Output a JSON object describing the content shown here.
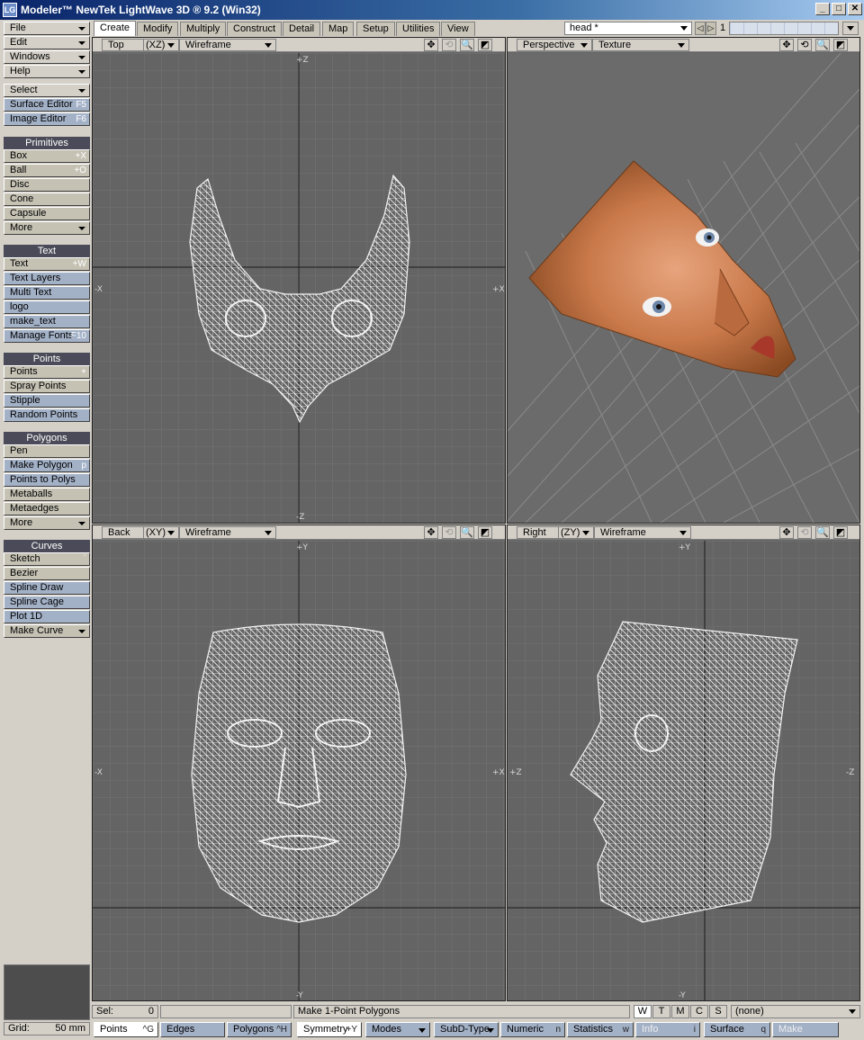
{
  "window": {
    "title": "Modeler™ NewTek LightWave 3D ® 9.2 (Win32)",
    "icon_text": "LG",
    "controls": [
      "_",
      "□",
      "✕"
    ]
  },
  "tabs": [
    "Create",
    "Modify",
    "Multiply",
    "Construct",
    "Detail",
    "Map",
    "Setup",
    "Utilities",
    "View"
  ],
  "active_tab": "Create",
  "layer": {
    "name": "head *",
    "number": "1",
    "prev": "◁",
    "next": "▷"
  },
  "left": {
    "menus": [
      {
        "label": "File"
      },
      {
        "label": "Edit"
      },
      {
        "label": "Windows"
      },
      {
        "label": "Help"
      }
    ],
    "tools": [
      {
        "label": "Select",
        "key": ""
      },
      {
        "label": "Surface Editor",
        "key": "F5"
      },
      {
        "label": "Image Editor",
        "key": "F6"
      }
    ],
    "primitives": {
      "title": "Primitives",
      "items": [
        {
          "label": "Box",
          "key": "+X"
        },
        {
          "label": "Ball",
          "key": "+O"
        },
        {
          "label": "Disc",
          "key": ""
        },
        {
          "label": "Cone",
          "key": ""
        },
        {
          "label": "Capsule",
          "key": ""
        },
        {
          "label": "More",
          "key": ""
        }
      ]
    },
    "text": {
      "title": "Text",
      "items": [
        {
          "label": "Text",
          "key": "+W"
        },
        {
          "label": "Text Layers",
          "key": ""
        },
        {
          "label": "Multi Text",
          "key": ""
        },
        {
          "label": "logo",
          "key": ""
        },
        {
          "label": "make_text",
          "key": ""
        },
        {
          "label": "Manage Fonts",
          "key": "F10"
        }
      ]
    },
    "points": {
      "title": "Points",
      "items": [
        {
          "label": "Points",
          "key": "+"
        },
        {
          "label": "Spray Points",
          "key": ""
        },
        {
          "label": "Stipple",
          "key": ""
        },
        {
          "label": "Random Points",
          "key": ""
        }
      ]
    },
    "polygons": {
      "title": "Polygons",
      "items": [
        {
          "label": "Pen",
          "key": ""
        },
        {
          "label": "Make Polygon",
          "key": "p"
        },
        {
          "label": "Points to Polys",
          "key": ""
        },
        {
          "label": "Metaballs",
          "key": ""
        },
        {
          "label": "Metaedges",
          "key": ""
        },
        {
          "label": "More",
          "key": ""
        }
      ]
    },
    "curves": {
      "title": "Curves",
      "items": [
        {
          "label": "Sketch",
          "key": "`"
        },
        {
          "label": "Bezier",
          "key": ""
        },
        {
          "label": "Spline Draw",
          "key": ""
        },
        {
          "label": "Spline Cage",
          "key": ""
        },
        {
          "label": "Plot 1D",
          "key": ""
        },
        {
          "label": "Make Curve",
          "key": ""
        }
      ]
    }
  },
  "viewports": {
    "top": {
      "view": "Top",
      "axes": "(XZ)",
      "mode": "Wireframe",
      "labels": {
        "up": "+Z",
        "down": "-Z",
        "left": "-X",
        "right": "+X"
      }
    },
    "persp": {
      "view": "Perspective",
      "mode": "Texture"
    },
    "back": {
      "view": "Back",
      "axes": "(XY)",
      "mode": "Wireframe",
      "labels": {
        "up": "+Y",
        "down": "-Y",
        "left": "-X",
        "right": "+X"
      }
    },
    "right": {
      "view": "Right",
      "axes": "(ZY)",
      "mode": "Wireframe",
      "labels": {
        "up": "+Y",
        "down": "-Y",
        "left": "+Z",
        "right": "-Z"
      }
    },
    "icons": [
      "✥",
      "⟲",
      "🔍",
      "◩"
    ]
  },
  "status": {
    "sel_label": "Sel:",
    "sel_value": "0",
    "message": "Make 1-Point Polygons",
    "view_buttons": [
      "W",
      "T",
      "M",
      "C",
      "S"
    ],
    "active_view_button": "W",
    "surface_select": "(none)"
  },
  "bottom": {
    "grid_label": "Grid:",
    "grid_value": "50 mm",
    "buttons": [
      {
        "label": "Points",
        "key": "^G"
      },
      {
        "label": "Edges",
        "key": ""
      },
      {
        "label": "Polygons",
        "key": "^H"
      },
      {
        "label": "Symmetry",
        "key": "+Y"
      },
      {
        "label": "Modes",
        "key": ""
      },
      {
        "label": "SubD-Type",
        "key": ""
      },
      {
        "label": "Numeric",
        "key": "n"
      },
      {
        "label": "Statistics",
        "key": "w"
      },
      {
        "label": "Info",
        "key": "i"
      },
      {
        "label": "Surface",
        "key": "q"
      },
      {
        "label": "Make",
        "key": ""
      }
    ]
  }
}
